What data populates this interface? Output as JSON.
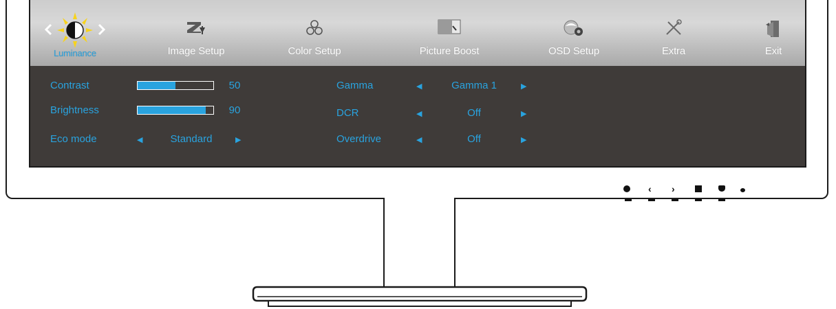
{
  "tabs": [
    {
      "label": "Luminance",
      "icon": "sun-icon",
      "active": true
    },
    {
      "label": "Image Setup",
      "icon": "image-setup-icon"
    },
    {
      "label": "Color Setup",
      "icon": "color-setup-icon"
    },
    {
      "label": "Picture Boost",
      "icon": "picture-boost-icon"
    },
    {
      "label": "OSD Setup",
      "icon": "osd-setup-icon"
    },
    {
      "label": "Extra",
      "icon": "extra-tools-icon"
    },
    {
      "label": "Exit",
      "icon": "exit-icon"
    }
  ],
  "settings": {
    "contrast": {
      "label": "Contrast",
      "value": "50",
      "level": 0.5
    },
    "brightness": {
      "label": "Brightness",
      "value": "90",
      "level": 0.9
    },
    "eco_mode": {
      "label": "Eco mode",
      "value": "Standard"
    },
    "gamma": {
      "label": "Gamma",
      "value": "Gamma 1"
    },
    "dcr": {
      "label": "DCR",
      "value": "Off"
    },
    "overdrive": {
      "label": "Overdrive",
      "value": "Off"
    }
  },
  "colors": {
    "accent": "#29a3df",
    "panel": "#3f3b39",
    "tabbar": "#c8c8c8"
  }
}
